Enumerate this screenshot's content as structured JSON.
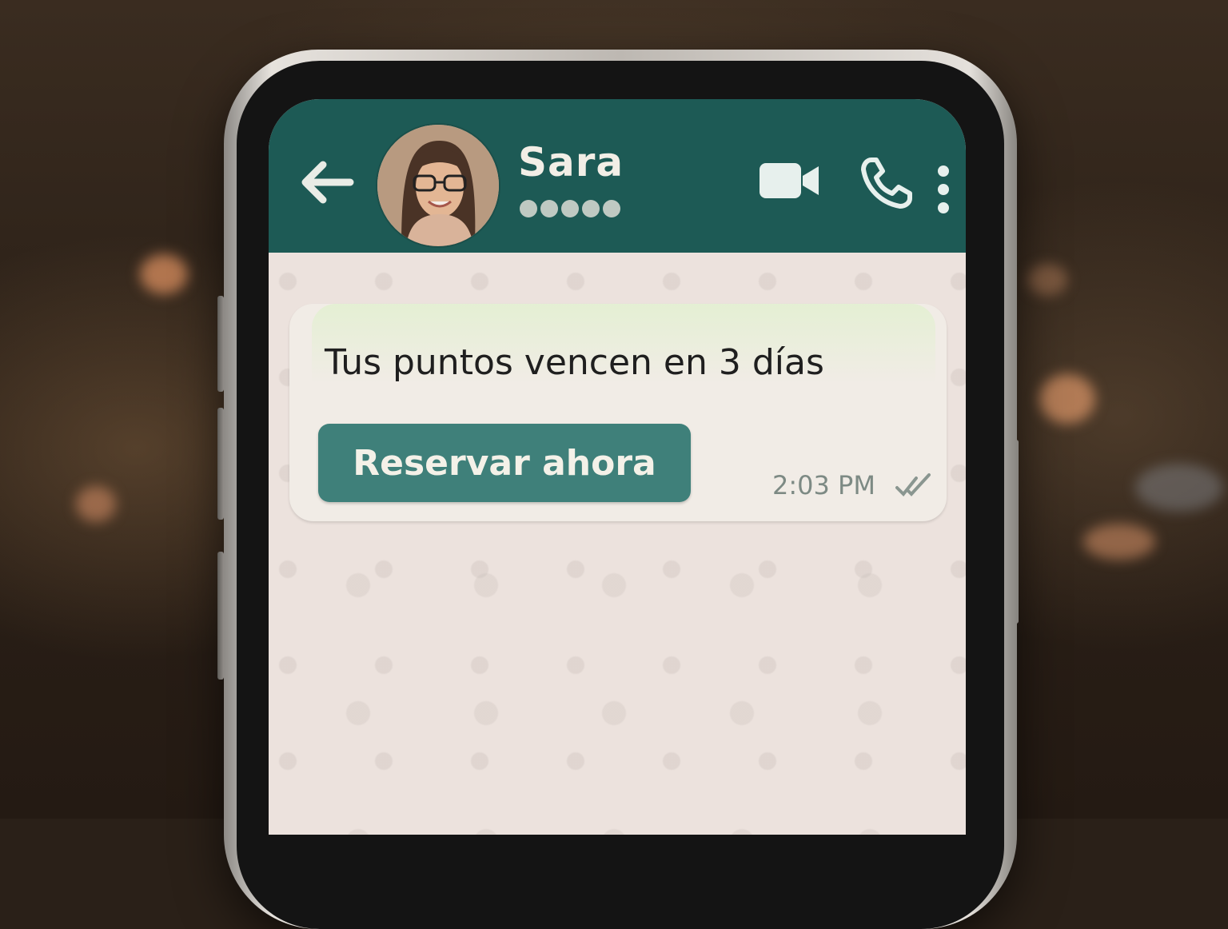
{
  "contact": {
    "name": "Sara",
    "status_obscured": true
  },
  "header": {
    "icons": [
      "back-arrow-icon",
      "video-call-icon",
      "phone-call-icon",
      "more-options-icon"
    ]
  },
  "message": {
    "text": "Tus puntos vencen en 3 días",
    "button_label": "Reservar ahora",
    "time": "2:03 PM",
    "status_icon": "double-check-icon"
  },
  "colors": {
    "header": "#1d5a55",
    "button": "#3f807a",
    "chat_background": "#ece2dd",
    "bubble": "#f1ece6"
  }
}
